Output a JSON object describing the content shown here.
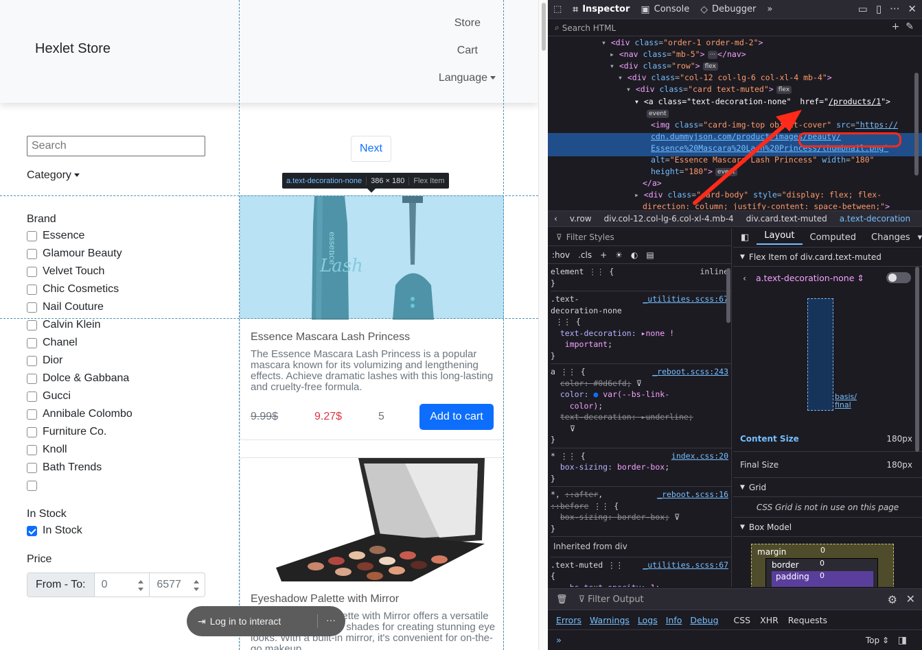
{
  "page": {
    "brand": "Hexlet Store",
    "nav": {
      "store": "Store",
      "cart": "Cart",
      "language": "Language"
    },
    "search_placeholder": "Search",
    "category": "Category",
    "next": "Next",
    "brand_title": "Brand",
    "brands": [
      "Essence",
      "Glamour Beauty",
      "Velvet Touch",
      "Chic Cosmetics",
      "Nail Couture",
      "Calvin Klein",
      "Chanel",
      "Dior",
      "Dolce & Gabbana",
      "Gucci",
      "Annibale Colombo",
      "Furniture Co.",
      "Knoll",
      "Bath Trends",
      ""
    ],
    "instock_title": "In Stock",
    "instock_label": "In Stock",
    "price_title": "Price",
    "price_label": "From - To:",
    "price_from": "0",
    "price_to": "6577",
    "products": [
      {
        "title": "Essence Mascara Lash Princess",
        "description": "The Essence Mascara Lash Princess is a popular mascara known for its volumizing and lengthening effects. Achieve dramatic lashes with this long-lasting and cruelty-free formula.",
        "old_price": "9.99$",
        "price": "9.27$",
        "stock": "5",
        "add_to_cart": "Add to cart"
      },
      {
        "title": "Eyeshadow Palette with Mirror",
        "description": "The Eyeshadow Palette with Mirror offers a versatile range of eyeshadow shades for creating stunning eye looks. With a built-in mirror, it's convenient for on-the-go makeup"
      }
    ],
    "tooltip": {
      "selector": "a.text-decoration-none",
      "size": "386 × 180",
      "kind": "Flex Item"
    },
    "login_toast": {
      "label": "Log in to interact",
      "more": "···"
    }
  },
  "devtools": {
    "tabs": {
      "inspector": "Inspector",
      "console": "Console",
      "debugger": "Debugger"
    },
    "search_html": "Search HTML",
    "breadcrumbs": [
      "v.row",
      "div.col-12.col-lg-6.col-xl-4.mb-4",
      "div.card.text-muted",
      "a.text-decoration"
    ],
    "filter_styles": "Filter Styles",
    "hov": ":hov",
    "cls": ".cls",
    "layout_tabs": {
      "layout": "Layout",
      "computed": "Computed",
      "changes": "Changes"
    },
    "flex_item_of": "Flex Item of div.card.text-muted",
    "flex_selected": "a.text-decoration-none ⇕",
    "basis_label_1": "basis/",
    "basis_label_2": "final",
    "content_size": {
      "label": "Content Size",
      "value": "180px"
    },
    "final_size": {
      "label": "Final Size",
      "value": "180px"
    },
    "grid_title": "Grid",
    "grid_note": "CSS Grid is not in use on this page",
    "box_model_title": "Box Model",
    "box_model": {
      "margin": "margin",
      "border": "border",
      "padding": "padding",
      "zero": "0"
    },
    "inherited_from": "Inherited from div",
    "filter_output": "Filter Output",
    "levels": [
      "Errors",
      "Warnings",
      "Logs",
      "Info",
      "Debug"
    ],
    "net": [
      "CSS",
      "XHR",
      "Requests"
    ],
    "top": "Top"
  }
}
